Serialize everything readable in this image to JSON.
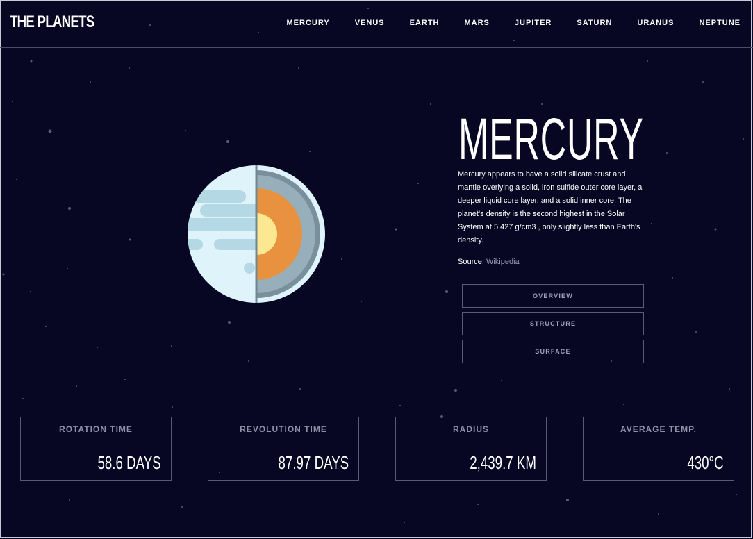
{
  "header": {
    "logo": "THE PLANETS",
    "nav": [
      "MERCURY",
      "VENUS",
      "EARTH",
      "MARS",
      "JUPITER",
      "SATURN",
      "URANUS",
      "NEPTUNE"
    ]
  },
  "planet": {
    "name": "MERCURY",
    "description": "Mercury appears to have a solid silicate crust and mantle overlying a solid, iron sulfide outer core layer, a deeper liquid core layer, and a solid inner core. The planet's density is the second highest in the Solar System at 5.427 g/cm3 , only slightly less than Earth's density.",
    "source_label": "Source:",
    "source_link": "Wikipedia",
    "icon": "planet-mercury-structure-icon"
  },
  "tabs": [
    "OVERVIEW",
    "STRUCTURE",
    "SURFACE"
  ],
  "stats": [
    {
      "label": "ROTATION TIME",
      "value": "58.6 DAYS"
    },
    {
      "label": "REVOLUTION TIME",
      "value": "87.97 DAYS"
    },
    {
      "label": "RADIUS",
      "value": "2,439.7 KM"
    },
    {
      "label": "AVERAGE TEMP.",
      "value": "430°C"
    }
  ],
  "colors": {
    "background": "#070724",
    "border": "#5a5a78",
    "crust": "#dff3fb",
    "mantle": "#97aebb",
    "outer_core": "#e8913e",
    "inner_core": "#fbe891"
  }
}
